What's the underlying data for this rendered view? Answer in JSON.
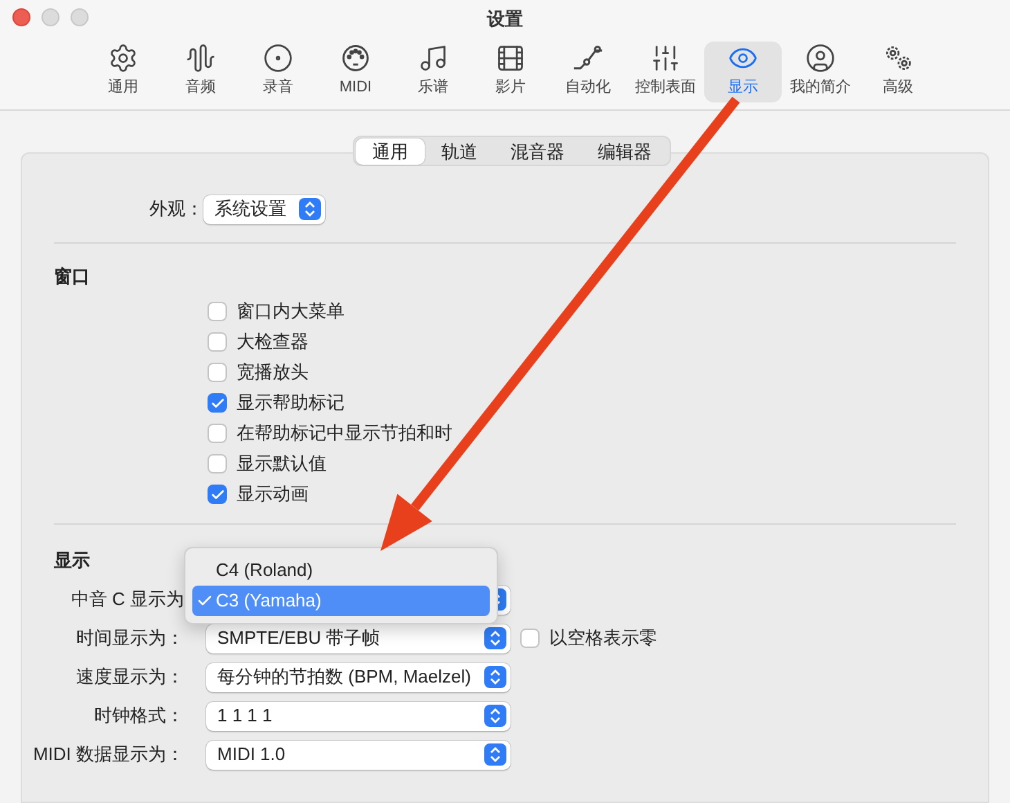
{
  "window": {
    "title": "设置"
  },
  "toolbar": [
    {
      "label": "通用",
      "selected": false
    },
    {
      "label": "音频",
      "selected": false
    },
    {
      "label": "录音",
      "selected": false
    },
    {
      "label": "MIDI",
      "selected": false
    },
    {
      "label": "乐谱",
      "selected": false
    },
    {
      "label": "影片",
      "selected": false
    },
    {
      "label": "自动化",
      "selected": false
    },
    {
      "label": "控制表面",
      "selected": false
    },
    {
      "label": "显示",
      "selected": true
    },
    {
      "label": "我的简介",
      "selected": false
    },
    {
      "label": "高级",
      "selected": false
    }
  ],
  "tabs": [
    {
      "label": "通用",
      "selected": true
    },
    {
      "label": "轨道",
      "selected": false
    },
    {
      "label": "混音器",
      "selected": false
    },
    {
      "label": "编辑器",
      "selected": false
    }
  ],
  "appearance": {
    "label": "外观：",
    "value": "系统设置"
  },
  "window_section": {
    "heading": "窗口",
    "options": [
      {
        "label": "窗口内大菜单",
        "checked": false
      },
      {
        "label": "大检查器",
        "checked": false
      },
      {
        "label": "宽播放头",
        "checked": false
      },
      {
        "label": "显示帮助标记",
        "checked": true
      },
      {
        "label": "在帮助标记中显示节拍和时",
        "checked": false
      },
      {
        "label": "显示默认值",
        "checked": false
      },
      {
        "label": "显示动画",
        "checked": true
      }
    ]
  },
  "display_section": {
    "heading": "显示",
    "rows": [
      {
        "label": "中音 C 显示为"
      },
      {
        "label": "时间显示为：",
        "value": "SMPTE/EBU 带子帧",
        "extra": {
          "label": "以空格表示零",
          "checked": false
        }
      },
      {
        "label": "速度显示为：",
        "value": "每分钟的节拍数 (BPM, Maelzel)"
      },
      {
        "label": "时钟格式：",
        "value": "1  1  1  1"
      },
      {
        "label": "MIDI 数据显示为：",
        "value": "MIDI 1.0"
      }
    ]
  },
  "popup_menu": {
    "items": [
      {
        "label": "C4 (Roland)",
        "selected": false
      },
      {
        "label": "C3 (Yamaha)",
        "selected": true
      }
    ]
  }
}
